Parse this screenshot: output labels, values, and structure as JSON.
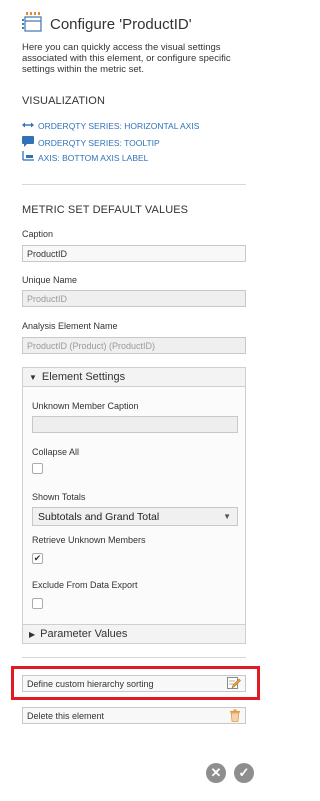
{
  "header": {
    "title": "Configure 'ProductID'",
    "icon": "configure-table-icon"
  },
  "intro": "Here you can quickly access the visual settings associated with this element, or configure specific settings within the metric set.",
  "visualization": {
    "title": "VISUALIZATION",
    "items": [
      {
        "label": "ORDERQTY SERIES: HORIZONTAL AXIS",
        "icon": "horizontal-axis-icon"
      },
      {
        "label": "ORDERQTY SERIES: TOOLTIP",
        "icon": "tooltip-icon"
      },
      {
        "label": "AXIS: BOTTOM AXIS LABEL",
        "icon": "axis-label-icon"
      }
    ],
    "link_color": "#3072b8"
  },
  "metric_set": {
    "title": "METRIC SET DEFAULT VALUES",
    "caption": {
      "label": "Caption",
      "value": "ProductID"
    },
    "unique_name": {
      "label": "Unique Name",
      "value": "ProductID"
    },
    "analysis_element": {
      "label": "Analysis Element Name",
      "value": "ProductID (Product) (ProductID)"
    }
  },
  "element_settings": {
    "title": "Element Settings",
    "unknown_member_caption": {
      "label": "Unknown Member Caption",
      "value": ""
    },
    "collapse_all": {
      "label": "Collapse All",
      "checked": false
    },
    "shown_totals": {
      "label": "Shown Totals",
      "value": "Subtotals and Grand Total"
    },
    "retrieve_unknown": {
      "label": "Retrieve Unknown Members",
      "checked": true,
      "mark": "✔"
    },
    "exclude_export": {
      "label": "Exclude From Data Export",
      "checked": false
    }
  },
  "parameter_values": {
    "title": "Parameter Values"
  },
  "actions": {
    "define_sorting": {
      "label": "Define custom hierarchy sorting",
      "icon": "edit-pencil-icon"
    },
    "delete_element": {
      "label": "Delete this element",
      "icon": "trash-icon"
    },
    "highlight_color": "#e01b24"
  },
  "footer": {
    "cancel_icon": "cancel-icon",
    "confirm_icon": "confirm-check-icon",
    "cancel_glyph": "✕",
    "confirm_glyph": "✓"
  }
}
